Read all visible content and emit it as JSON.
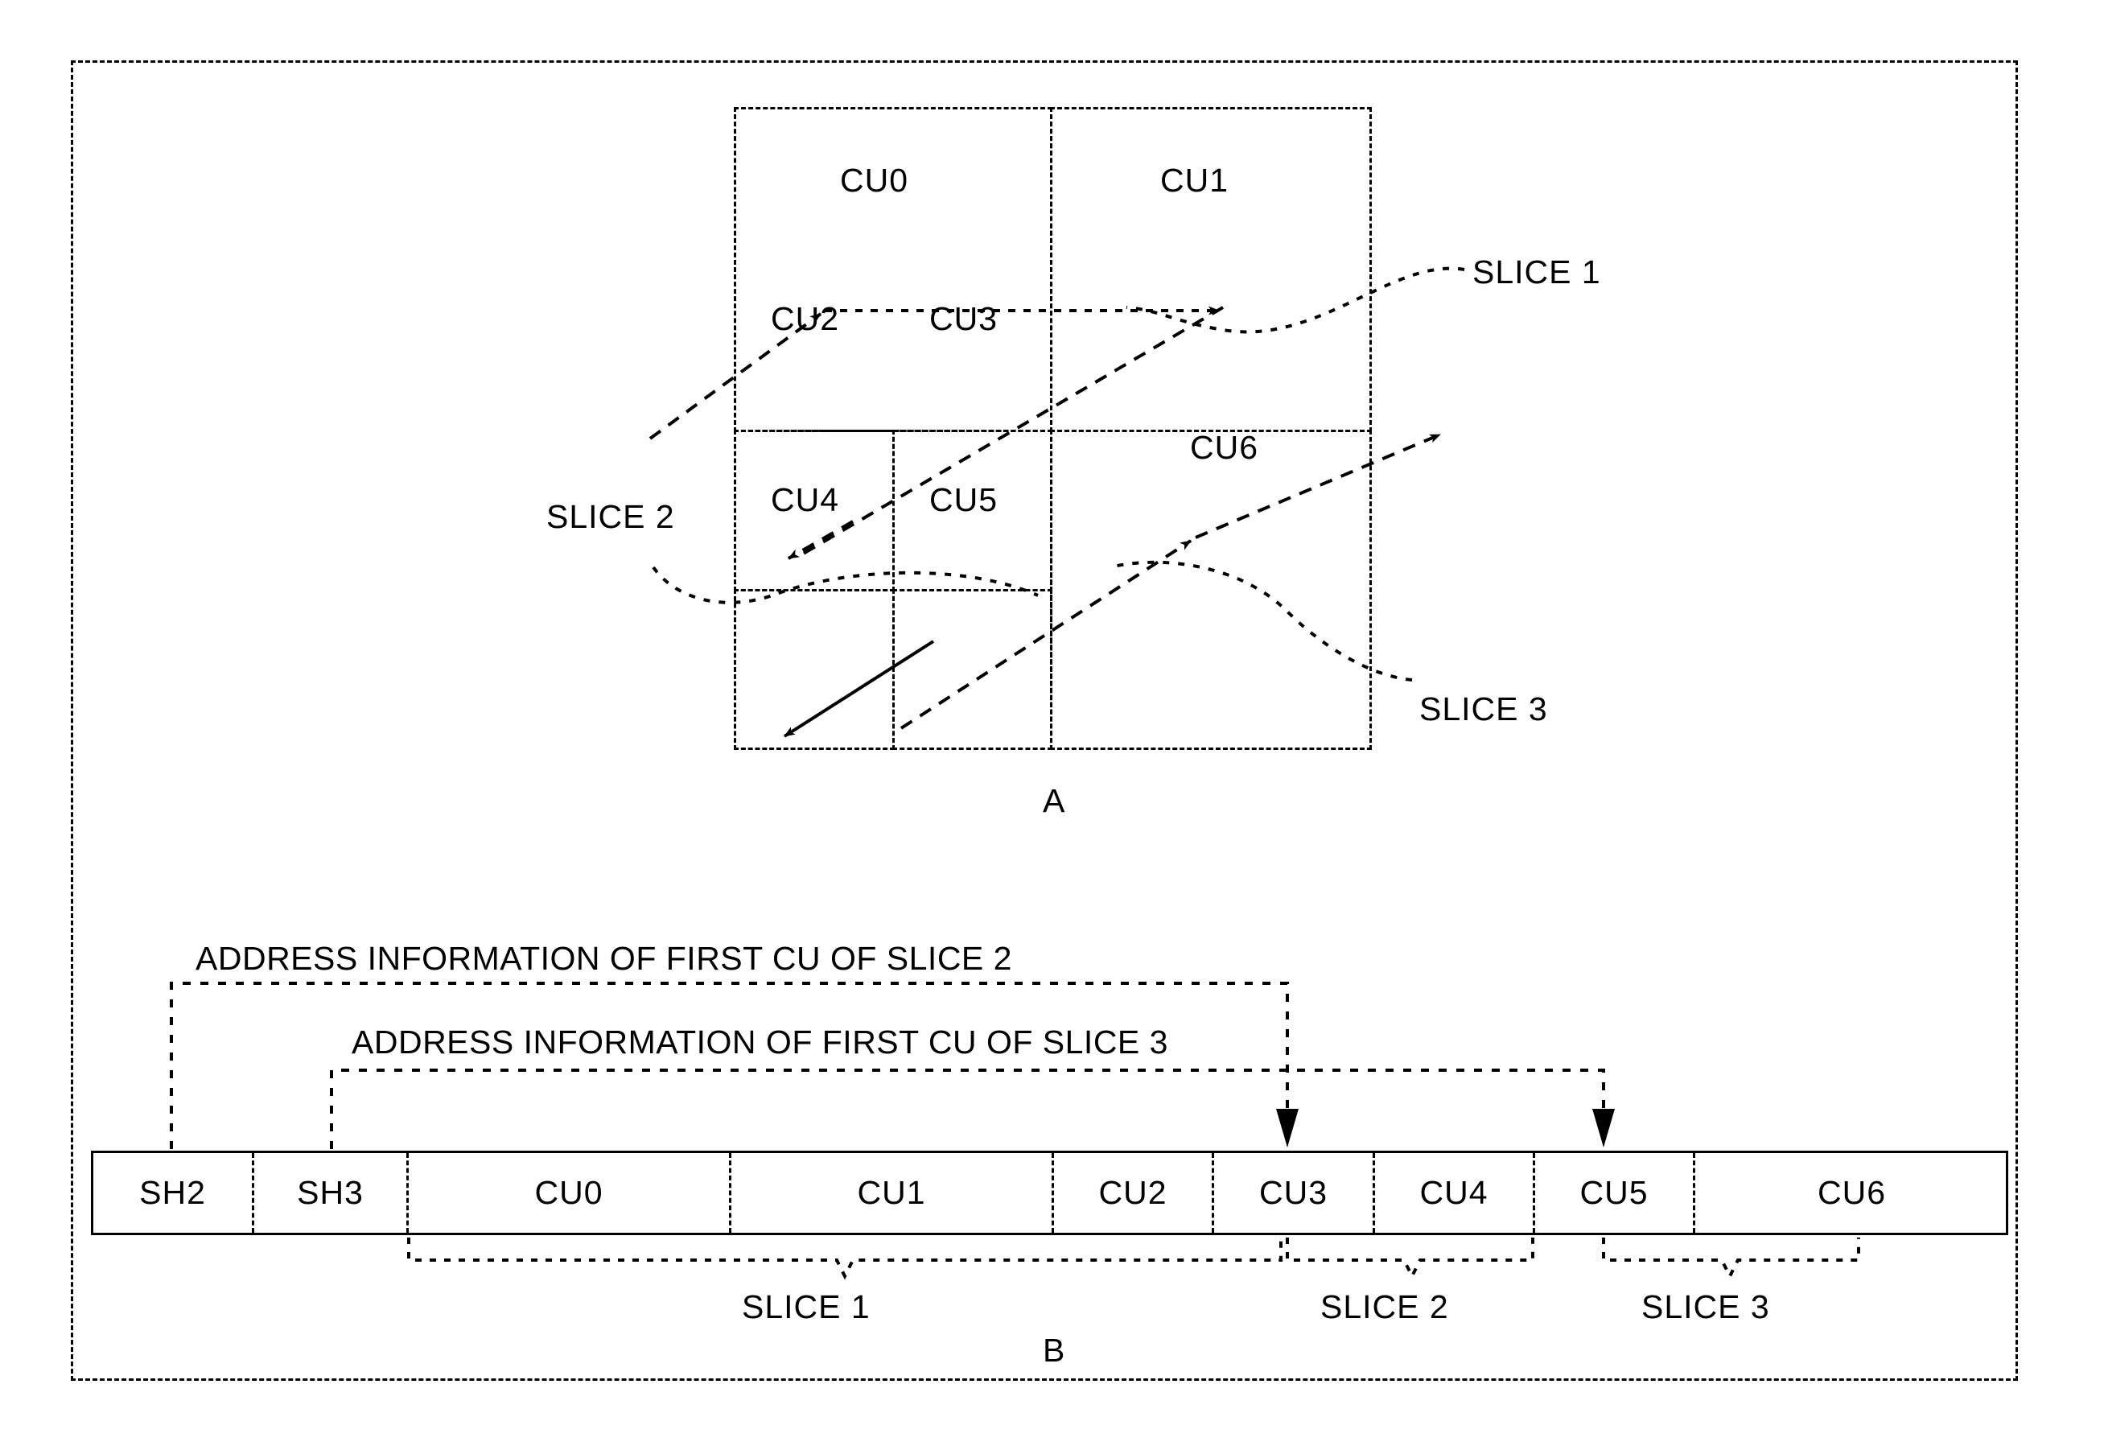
{
  "figure": {
    "panel_a_letter": "A",
    "panel_b_letter": "B"
  },
  "panel_a": {
    "cu_labels": [
      "CU0",
      "CU1",
      "CU2",
      "CU3",
      "CU4",
      "CU5",
      "CU6"
    ],
    "callouts": [
      {
        "text": "SLICE 1"
      },
      {
        "text": "SLICE 2"
      },
      {
        "text": "SLICE 3"
      }
    ]
  },
  "panel_b": {
    "address_info_slice2": "ADDRESS INFORMATION OF FIRST CU OF SLICE 2",
    "address_info_slice3": "ADDRESS INFORMATION OF FIRST CU OF SLICE 3",
    "bitstream_cells": [
      {
        "label": "SH2"
      },
      {
        "label": "SH3"
      },
      {
        "label": "CU0"
      },
      {
        "label": "CU1"
      },
      {
        "label": "CU2"
      },
      {
        "label": "CU3"
      },
      {
        "label": "CU4"
      },
      {
        "label": "CU5"
      },
      {
        "label": "CU6"
      }
    ],
    "slice_braces": [
      {
        "label": "SLICE 1"
      },
      {
        "label": "SLICE 2"
      },
      {
        "label": "SLICE 3"
      }
    ]
  },
  "colors": {
    "ink": "#000000",
    "paper": "#ffffff"
  }
}
